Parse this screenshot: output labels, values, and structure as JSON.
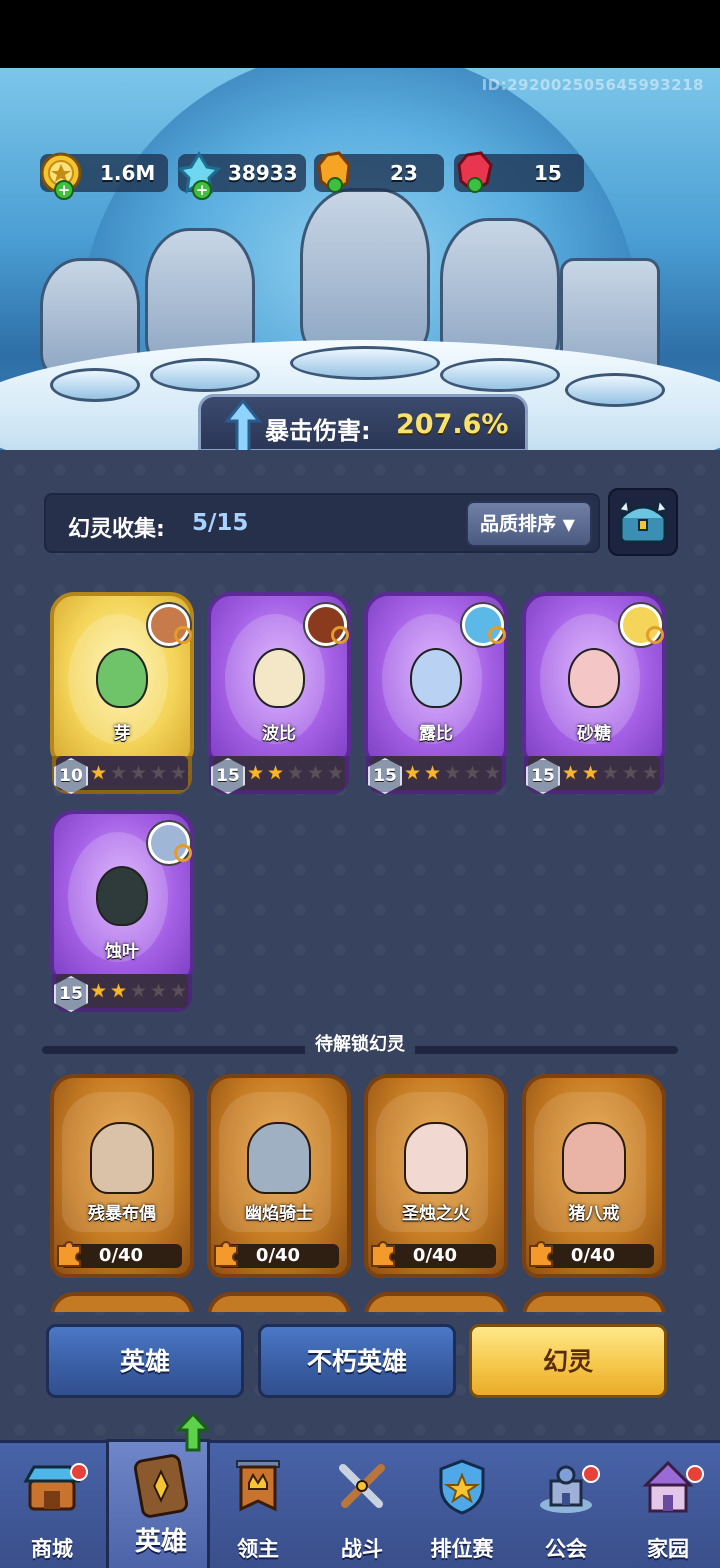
{
  "player_id": "ID:292002505645993218",
  "resources": [
    {
      "name": "gold",
      "icon": "gold-coin-icon",
      "value": "1.6M"
    },
    {
      "name": "diamond",
      "icon": "blue-crystal-icon",
      "value": "38933"
    },
    {
      "name": "orange-crystal",
      "icon": "orange-crystal-icon",
      "value": "23"
    },
    {
      "name": "red-crystal",
      "icon": "red-crystal-icon",
      "value": "15"
    }
  ],
  "crit": {
    "label": "暴击伤害:",
    "value": "207.6%"
  },
  "collection": {
    "label": "幻灵收集:",
    "value": "5/15",
    "sort_label": "品质排序"
  },
  "owned": [
    {
      "name": "芽",
      "level": "10",
      "stars": 1,
      "rarity": "gold",
      "sprite_color": "#6fc46a"
    },
    {
      "name": "波比",
      "level": "15",
      "stars": 2,
      "rarity": "purple",
      "sprite_color": "#f3e7c8"
    },
    {
      "name": "露比",
      "level": "15",
      "stars": 2,
      "rarity": "purple",
      "sprite_color": "#b9d2f3"
    },
    {
      "name": "砂糖",
      "level": "15",
      "stars": 2,
      "rarity": "purple",
      "sprite_color": "#f5c6c6"
    },
    {
      "name": "蚀叶",
      "level": "15",
      "stars": 2,
      "rarity": "purple",
      "sprite_color": "#2f3b3a"
    }
  ],
  "locked_title": "待解锁幻灵",
  "locked": [
    {
      "name": "残暴布偶",
      "progress": "0/40",
      "sprite_color": "#d9c2a8"
    },
    {
      "name": "幽焰骑士",
      "progress": "0/40",
      "sprite_color": "#9fb0c2"
    },
    {
      "name": "圣烛之火",
      "progress": "0/40",
      "sprite_color": "#f1d9d1"
    },
    {
      "name": "猪八戒",
      "progress": "0/40",
      "sprite_color": "#e9b4a6"
    }
  ],
  "switch_tabs": [
    "英雄",
    "不朽英雄",
    "幻灵"
  ],
  "nav": [
    {
      "label": "商城",
      "icon": "shop-icon",
      "badge": true
    },
    {
      "label": "英雄",
      "icon": "hero-card-icon",
      "badge": false,
      "active": true
    },
    {
      "label": "领主",
      "icon": "lord-banner-icon",
      "badge": false
    },
    {
      "label": "战斗",
      "icon": "crossed-swords-icon",
      "badge": false
    },
    {
      "label": "排位赛",
      "icon": "ranked-shield-icon",
      "badge": false
    },
    {
      "label": "公会",
      "icon": "guild-castle-icon",
      "badge": true
    },
    {
      "label": "家园",
      "icon": "home-castle-icon",
      "badge": true
    }
  ],
  "colors": {
    "accent_gold": "#f7e26b",
    "panel": "#38435f",
    "nav": "#4863a8"
  }
}
